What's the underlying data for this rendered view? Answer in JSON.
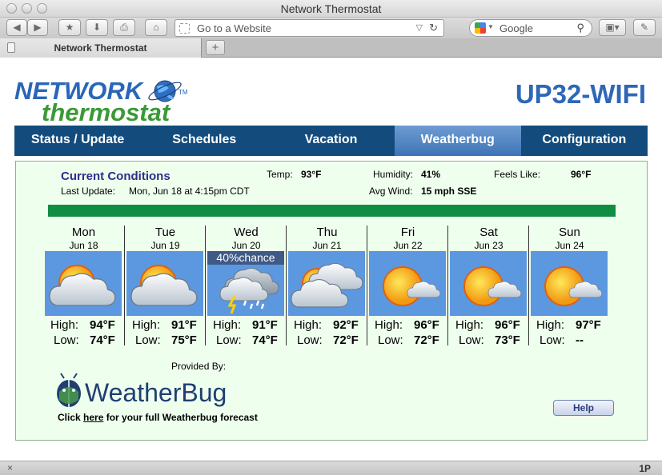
{
  "window": {
    "title": "Network Thermostat"
  },
  "toolbar": {
    "address_placeholder": "Go to a Website",
    "search_placeholder": "Google"
  },
  "tab": {
    "label": "Network Thermostat",
    "new_tab": "+"
  },
  "header": {
    "logo_top": "NETWORK",
    "logo_bottom": "thermostat",
    "logo_tm": "TM",
    "model": "UP32-WIFI"
  },
  "nav": [
    {
      "label": "Status / Update",
      "active": false
    },
    {
      "label": "Schedules",
      "active": false
    },
    {
      "label": "Vacation",
      "active": false
    },
    {
      "label": "Weatherbug",
      "active": true
    },
    {
      "label": "Configuration",
      "active": false
    }
  ],
  "conditions": {
    "title": "Current Conditions",
    "last_update_label": "Last Update:",
    "last_update_value": "Mon, Jun 18 at 4:15pm CDT",
    "temp_label": "Temp:",
    "temp_value": "93°F",
    "humidity_label": "Humidity:",
    "humidity_value": "41%",
    "feels_label": "Feels Like:",
    "feels_value": "96°F",
    "wind_label": "Avg Wind:",
    "wind_value": "15 mph SSE",
    "bar_color": "#0f8d42"
  },
  "forecast": [
    {
      "day": "Mon",
      "date": "Jun 18",
      "icon": "partly-cloudy-icon",
      "chance": "",
      "high_label": "High:",
      "high": "94°F",
      "low_label": "Low:",
      "low": "74°F"
    },
    {
      "day": "Tue",
      "date": "Jun 19",
      "icon": "partly-cloudy-icon",
      "chance": "",
      "high_label": "High:",
      "high": "91°F",
      "low_label": "Low:",
      "low": "75°F"
    },
    {
      "day": "Wed",
      "date": "Jun 20",
      "icon": "thunderstorm-icon",
      "chance": "40%chance",
      "high_label": "High:",
      "high": "91°F",
      "low_label": "Low:",
      "low": "74°F"
    },
    {
      "day": "Thu",
      "date": "Jun 21",
      "icon": "cloudy-icon",
      "chance": "",
      "high_label": "High:",
      "high": "92°F",
      "low_label": "Low:",
      "low": "72°F"
    },
    {
      "day": "Fri",
      "date": "Jun 22",
      "icon": "mostly-sunny-icon",
      "chance": "",
      "high_label": "High:",
      "high": "96°F",
      "low_label": "Low:",
      "low": "72°F"
    },
    {
      "day": "Sat",
      "date": "Jun 23",
      "icon": "mostly-sunny-icon",
      "chance": "",
      "high_label": "High:",
      "high": "96°F",
      "low_label": "Low:",
      "low": "73°F"
    },
    {
      "day": "Sun",
      "date": "Jun 24",
      "icon": "mostly-sunny-icon",
      "chance": "",
      "high_label": "High:",
      "high": "97°F",
      "low_label": "Low:",
      "low": "--"
    }
  ],
  "provided_by": "Provided By:",
  "weatherbug_logo": "WeatherBug",
  "click_pre": "Click ",
  "click_link": "here",
  "click_post": " for your full Weatherbug forecast",
  "help_label": "Help",
  "statusbar": {
    "close": "×",
    "right": "1P"
  }
}
